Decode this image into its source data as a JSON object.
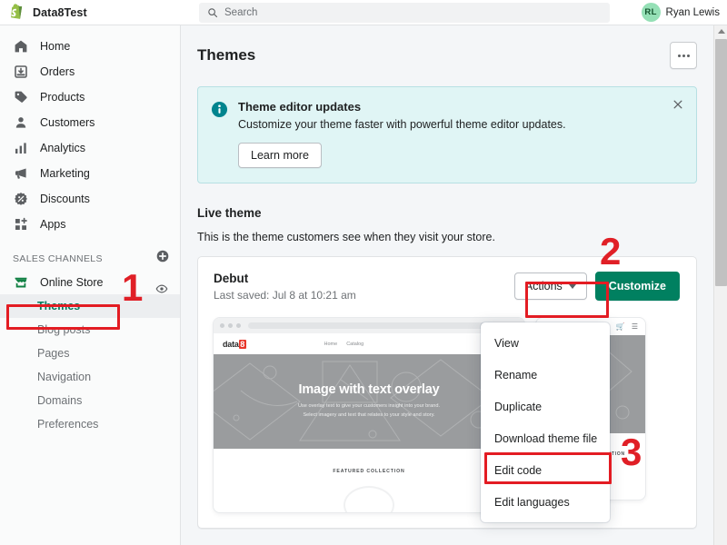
{
  "topbar": {
    "logo_icon": "shopify-bag-icon",
    "store_name": "Data8Test",
    "search": {
      "icon": "search-icon",
      "placeholder": "Search",
      "value": ""
    },
    "user": {
      "initials": "RL",
      "name": "Ryan Lewis"
    }
  },
  "sidebar": {
    "items": [
      {
        "label": "Home",
        "icon": "home-icon"
      },
      {
        "label": "Orders",
        "icon": "orders-inbox-icon"
      },
      {
        "label": "Products",
        "icon": "tag-icon"
      },
      {
        "label": "Customers",
        "icon": "person-icon"
      },
      {
        "label": "Analytics",
        "icon": "bar-chart-icon"
      },
      {
        "label": "Marketing",
        "icon": "megaphone-icon"
      },
      {
        "label": "Discounts",
        "icon": "discount-badge-icon"
      },
      {
        "label": "Apps",
        "icon": "apps-grid-plus-icon"
      }
    ],
    "section_title": "SALES CHANNELS",
    "add_channel_icon": "plus-circle-icon",
    "channel": {
      "label": "Online Store",
      "icon": "storefront-icon",
      "view_icon": "eye-icon"
    },
    "sub_items": [
      {
        "label": "Themes",
        "active": true
      },
      {
        "label": "Blog posts",
        "active": false
      },
      {
        "label": "Pages",
        "active": false
      },
      {
        "label": "Navigation",
        "active": false
      },
      {
        "label": "Domains",
        "active": false
      },
      {
        "label": "Preferences",
        "active": false
      }
    ]
  },
  "main": {
    "page_title": "Themes",
    "more_button_icon": "ellipsis-icon",
    "banner": {
      "icon": "info-circle-icon",
      "title": "Theme editor updates",
      "text": "Customize your theme faster with powerful theme editor updates.",
      "button_label": "Learn more",
      "close_icon": "close-icon"
    },
    "live_theme": {
      "heading": "Live theme",
      "description": "This is the theme customers see when they visit your store.",
      "name": "Debut",
      "last_saved": "Last saved: Jul 8 at 10:21 am",
      "actions_label": "Actions",
      "actions_caret_icon": "chevron-down-icon",
      "customize_label": "Customize"
    },
    "preview": {
      "site_logo": "data8",
      "site_logo_mark": "8",
      "nav": [
        "Home",
        "Catalog"
      ],
      "search_icon": "search-icon",
      "hero_title": "Image with text overlay",
      "hero_subtitle_line1": "Use overlay text to give your customers insight into your brand.",
      "hero_subtitle_line2": "Select imagery and text that relates to your style and story.",
      "featured_label": "FEATURED COLLECTION",
      "mobile_hero_title": "xt",
      "mobile_menu_icon": "hamburger-icon",
      "mobile_cart_icon": "cart-icon",
      "mobile_featured_label": "FEATURED COLLECTION"
    },
    "dropdown": {
      "items": [
        {
          "label": "View"
        },
        {
          "label": "Rename"
        },
        {
          "label": "Duplicate"
        },
        {
          "label": "Download theme file"
        },
        {
          "label": "Edit code"
        },
        {
          "label": "Edit languages"
        }
      ]
    }
  },
  "annotations": {
    "step1": "1",
    "step2": "2",
    "step3": "3",
    "color": "#e31c23"
  },
  "scrollbar": {
    "up_arrow_icon": "scroll-up-arrow-icon"
  }
}
